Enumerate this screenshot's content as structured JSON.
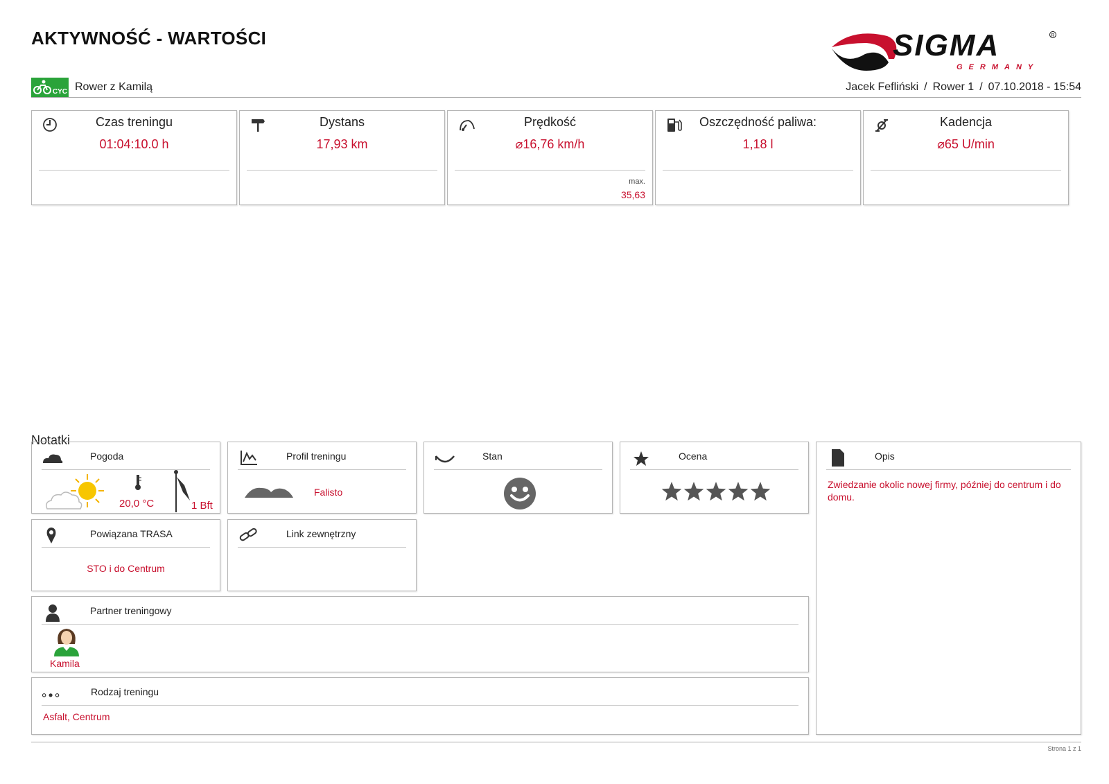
{
  "header": {
    "title": "AKTYWNOŚĆ - WARTOŚCI",
    "logo_text": "SIGMA",
    "logo_sub": "GERMANY"
  },
  "activity": {
    "badge": "CYC",
    "name": "Rower z Kamilą",
    "user": "Jacek Fefliński",
    "bike": "Rower 1",
    "datetime": "07.10.2018 - 15:54"
  },
  "stats": [
    {
      "label": "Czas treningu",
      "value": "01:04:10.0 h",
      "icon": "clock-icon"
    },
    {
      "label": "Dystans",
      "value": "17,93 km",
      "icon": "signpost-icon"
    },
    {
      "label": "Prędkość",
      "value": "⌀16,76 km/h",
      "icon": "speedometer-icon",
      "max_label": "max.",
      "max_value": "35,63"
    },
    {
      "label": "Oszczędność paliwa:",
      "value": "1,18 l",
      "icon": "fuel-pump-icon"
    },
    {
      "label": "Kadencja",
      "value": "⌀65 U/min",
      "icon": "cadence-icon"
    }
  ],
  "notes": {
    "title": "Notatki",
    "weather": {
      "label": "Pogoda",
      "temperature": "20,0 °C",
      "wind": "1 Bft"
    },
    "profile": {
      "label": "Profil treningu",
      "value": "Falisto"
    },
    "condition": {
      "label": "Stan",
      "mood": "happy"
    },
    "rating": {
      "label": "Ocena",
      "stars": 5,
      "max_stars": 5
    },
    "description": {
      "label": "Opis",
      "text": "Zwiedzanie okolic nowej firmy, później do centrum i do domu."
    },
    "route": {
      "label": "Powiązana TRASA",
      "value": "STO i do Centrum"
    },
    "link": {
      "label": "Link zewnętrzny"
    },
    "partner": {
      "label": "Partner treningowy",
      "name": "Kamila"
    },
    "type": {
      "label": "Rodzaj treningu",
      "value": "Asfalt, Centrum"
    }
  },
  "colors": {
    "accent": "#c8102e",
    "badge": "#2aa33a",
    "icons": "#333333"
  },
  "footer": {
    "page": "Strona 1 z 1"
  }
}
